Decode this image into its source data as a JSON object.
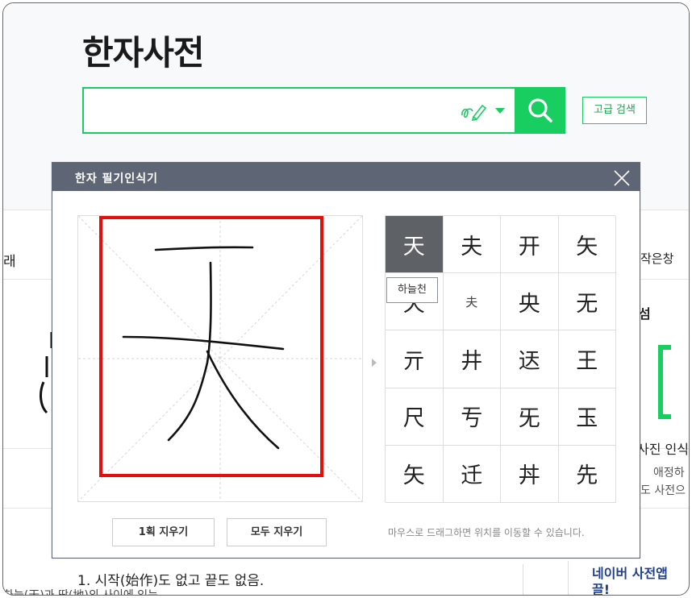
{
  "header": {
    "title": "한자사전",
    "search": {
      "value": "",
      "placeholder": ""
    },
    "advanced_search_label": "고급 검색"
  },
  "background": {
    "left_tab": "래",
    "right_tab": "작은창",
    "right_heading": "섬",
    "right_title": "사진 인식",
    "right_line1": "애정하",
    "right_line2": "도 사전으",
    "meaning_line1": "1. 시작(始作)도 없고 끝도 없음.",
    "meaning_line2": "하늘(天)과 땅(地)의 사이에 있는",
    "app_line1": "네이버 사전앱",
    "app_line2": "끌!"
  },
  "popup": {
    "title": "한자 필기인식기",
    "candidates": [
      "天",
      "夫",
      "开",
      "矢",
      "天",
      "夫",
      "央",
      "无",
      "亓",
      "井",
      "迗",
      "王",
      "尺",
      "亐",
      "旡",
      "玉",
      "矢",
      "迁",
      "丼",
      "先"
    ],
    "selected_index": 0,
    "small_indices": [
      5
    ],
    "tooltip": "하늘천",
    "clear_one_label": "1획 지우기",
    "clear_all_label": "모두 지우기",
    "drag_hint": "마우스로 드래그하면 위치를 이동할 수 있습니다."
  },
  "colors": {
    "brand_green": "#19ce60",
    "popup_header": "#5e6675",
    "selected_cell": "#5e6266",
    "guide_box": "#e30f0f"
  },
  "icons": {
    "pen": "handwriting-pen-icon",
    "dropdown": "chevron-down-icon",
    "search": "search-icon",
    "close": "close-icon"
  }
}
